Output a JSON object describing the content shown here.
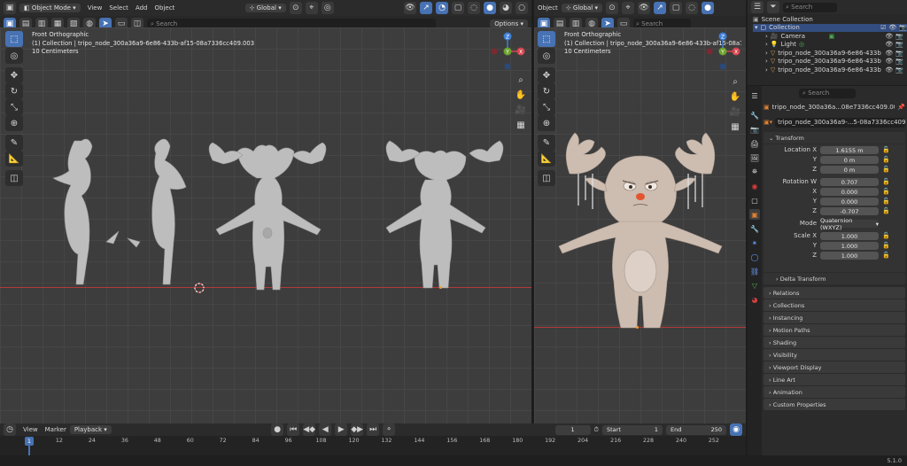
{
  "left_viewport": {
    "header": {
      "mode": "Object Mode",
      "menus": [
        "View",
        "Select",
        "Add",
        "Object"
      ],
      "transform_orientation": "Global",
      "search_placeholder": "Search",
      "options": "Options"
    },
    "overlay": {
      "view_name": "Front Orthographic",
      "collection": "(1) Collection | tripo_node_300a36a9-6e86-433b-af15-08a7336cc409.003",
      "scale": "10 Centimeters"
    }
  },
  "right_viewport": {
    "header": {
      "menu_partial": "Object",
      "transform_orientation": "Global",
      "search_placeholder": "Search"
    },
    "overlay": {
      "view_name": "Front Orthographic",
      "collection": "(1) Collection | tripo_node_300a36a9-6e86-433b-af15-08a7336cc409.003",
      "scale": "10 Centimeters"
    }
  },
  "gizmo": {
    "z": "Z",
    "y": "Y",
    "x": "X"
  },
  "outliner": {
    "search_placeholder": "Search",
    "root": "Scene Collection",
    "collection": "Collection",
    "items": [
      "Camera",
      "Light",
      "tripo_node_300a36a9-6e86-433b",
      "tripo_node_300a36a9-6e86-433b",
      "tripo_node_300a36a9-6e86-433b"
    ]
  },
  "properties": {
    "search_placeholder": "Search",
    "object_name": "tripo_node_300a36a...08e7336cc409.003",
    "data_name": "tripo_node_300a36a9-...5-08a7336cc409.003",
    "transform_label": "Transform",
    "location": {
      "label": "Location X",
      "x": "1.6155 m",
      "y": "0 m",
      "z": "0 m",
      "y_label": "Y",
      "z_label": "Z"
    },
    "rotation": {
      "label": "Rotation W",
      "w": "0.707",
      "x": "0.000",
      "y": "0.000",
      "z": "-0.707",
      "x_label": "X",
      "y_label": "Y",
      "z_label": "Z"
    },
    "mode": {
      "label": "Mode",
      "value": "Quaternion (WXYZ)"
    },
    "scale": {
      "label": "Scale X",
      "x": "1.000",
      "y": "1.000",
      "z": "1.000",
      "y_label": "Y",
      "z_label": "Z"
    },
    "delta_transform": "Delta Transform",
    "panels": [
      "Relations",
      "Collections",
      "Instancing",
      "Motion Paths",
      "Shading",
      "Visibility",
      "Viewport Display",
      "Line Art",
      "Animation",
      "Custom Properties"
    ]
  },
  "timeline": {
    "menus": [
      "View",
      "Marker",
      "Playback"
    ],
    "current_frame": "1",
    "start_label": "Start",
    "start": "1",
    "end_label": "End",
    "end": "250",
    "ruler": [
      "1",
      "12",
      "24",
      "36",
      "48",
      "60",
      "72",
      "84",
      "96",
      "108",
      "120",
      "132",
      "144",
      "156",
      "168",
      "180",
      "192",
      "204",
      "216",
      "228",
      "240",
      "252"
    ],
    "playhead": "1"
  },
  "status_bar": {
    "version": "5.1.0"
  },
  "colors": {
    "accent": "#4772b3",
    "x_axis": "#d6454f",
    "y_axis": "#6ca32d",
    "z_axis": "#3f7fd8",
    "floor_line": "#b23a3a"
  }
}
